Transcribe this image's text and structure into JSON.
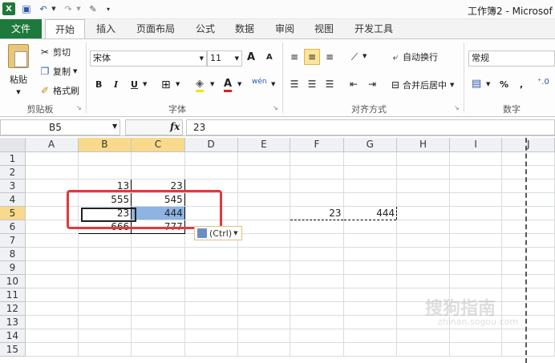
{
  "titlebar": {
    "logo": "X",
    "title": "工作簿2 - Microsof"
  },
  "tabs": {
    "file": "文件",
    "home": "开始",
    "insert": "插入",
    "layout": "页面布局",
    "formula": "公式",
    "data": "数据",
    "review": "审阅",
    "view": "视图",
    "developer": "开发工具"
  },
  "clipboard": {
    "paste": "粘贴",
    "cut": "剪切",
    "copy": "复制",
    "format_painter": "格式刷",
    "label": "剪贴板"
  },
  "font": {
    "name": "宋体",
    "size": "11",
    "grow": "A",
    "shrink": "A",
    "bold": "B",
    "italic": "I",
    "underline": "U",
    "font_color": "A",
    "phonetic": "wén",
    "label": "字体"
  },
  "alignment": {
    "wrap": "自动换行",
    "merge": "合并后居中",
    "label": "对齐方式"
  },
  "number": {
    "format": "常规",
    "percent": "%",
    "comma": ",",
    "label": "数字"
  },
  "formula_bar": {
    "name_box": "B5",
    "fx": "fx",
    "value": "23"
  },
  "grid": {
    "columns": [
      "A",
      "B",
      "C",
      "D",
      "E",
      "F",
      "G",
      "H",
      "I",
      "J"
    ],
    "rows": [
      "1",
      "2",
      "3",
      "4",
      "5",
      "6",
      "7",
      "8",
      "9",
      "10",
      "11",
      "12",
      "13",
      "14",
      "15"
    ],
    "cells": {
      "B3": "13",
      "C3": "23",
      "B4": "555",
      "C4": "545",
      "B5": "23",
      "C5": "444",
      "B6": "666",
      "C6": "777",
      "F5": "23",
      "G5": "444"
    }
  },
  "paste_options": {
    "label": "(Ctrl)"
  },
  "watermark": {
    "text": "搜狗指南",
    "sub": "zhinan.sogou.com"
  },
  "colors": {
    "file_tab": "#1e7a3c",
    "selection": "#8db4e3",
    "header_selected": "#f9d98b",
    "annotation": "#e5373c"
  }
}
